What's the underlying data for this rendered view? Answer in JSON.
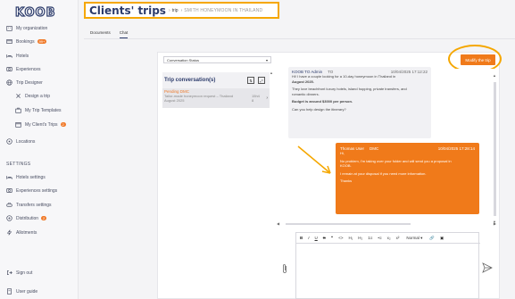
{
  "logo": {
    "text": "KOOB"
  },
  "sidebar": {
    "items": [
      {
        "label": "My organization",
        "icon": "building-icon"
      },
      {
        "label": "Bookings",
        "badge": "99+",
        "icon": "bookings-icon"
      },
      {
        "label": "Hotels",
        "icon": "bed-icon"
      },
      {
        "label": "Experiences",
        "icon": "experience-icon"
      },
      {
        "label": "Trip Designer",
        "icon": "globe-icon"
      }
    ],
    "sub_items": [
      {
        "label": "Design a trip",
        "icon": "design-icon"
      },
      {
        "label": "My Trip Templates",
        "icon": "briefcase-icon"
      },
      {
        "label": "My Client's Trips",
        "badge": "2",
        "icon": "client-trips-icon"
      }
    ],
    "locations": {
      "label": "Locations",
      "icon": "location-icon"
    },
    "settings_title": "SETTINGS",
    "settings_items": [
      {
        "label": "Hotels settings",
        "icon": "bed-icon"
      },
      {
        "label": "Experiences settings",
        "icon": "experience-icon"
      },
      {
        "label": "Transfers settings",
        "icon": "car-icon"
      },
      {
        "label": "Distribution",
        "badge": "2",
        "icon": "distribution-icon"
      },
      {
        "label": "Allotments",
        "icon": "bolt-icon"
      }
    ],
    "footer": [
      {
        "label": "Sign out",
        "icon": "sign-out-icon"
      },
      {
        "label": "User guide",
        "icon": "guide-icon"
      }
    ]
  },
  "header": {
    "title": "Clients' trips",
    "separator": "›",
    "crumb": "trip",
    "crumb_sep": "›",
    "trip_name": "SMITH HONEYMOON IN THAILAND"
  },
  "tabs": [
    {
      "label": "Documents",
      "active": false
    },
    {
      "label": "Chat",
      "active": true
    }
  ],
  "conversation_status": {
    "value": "Conversation Status"
  },
  "conversations": {
    "title": "Trip conversation(s)",
    "items": [
      {
        "status": "Pending DMC",
        "request_lines": [
          "Tailor-made honeymoon request – Thailand",
          "August 2025"
        ],
        "time_lines": [
          "15h4",
          "8"
        ]
      }
    ]
  },
  "modify_button": {
    "label": "Modify the trip"
  },
  "messages": {
    "incoming": {
      "from": "KOOB TO Admin",
      "role": "TO",
      "date": "10/04/2025 17:12:22",
      "paragraphs": [
        [
          "Hi! I have a couple looking for a 10-day honeymoon in Thailand in",
          "August 2025."
        ],
        [
          "They love beachfront luxury hotels, island hopping, private transfers, and",
          "romantic dinners."
        ],
        [
          "Budget is around $3000 per person."
        ],
        [
          "Can you help design the itinerary?"
        ]
      ]
    },
    "outgoing": {
      "from": "Thomas User",
      "role": "DMC",
      "date": "10/04/2025 17:28:14",
      "paragraphs": [
        [
          "Hi,"
        ],
        [
          "No problem, I'm taking over your folder and will send you a proposal in",
          "KOOB."
        ],
        [
          "I remain at your disposal if you need more information."
        ],
        [
          "Thanks"
        ]
      ]
    }
  },
  "editor": {
    "toolbar": {
      "bold": "B",
      "italic": "I",
      "underline": "U",
      "strike": "S",
      "quote": "❝",
      "code": "<>",
      "h1": "H₁",
      "h2": "H₂",
      "ol": "1≡",
      "ul": "•≡",
      "sub": "x₂",
      "sup": "x²",
      "format": "Normal",
      "link": "🔗",
      "image": "▣"
    }
  },
  "colors": {
    "brand": "#2c3b6b",
    "accent": "#f07a1a",
    "highlight": "#f5a700"
  }
}
